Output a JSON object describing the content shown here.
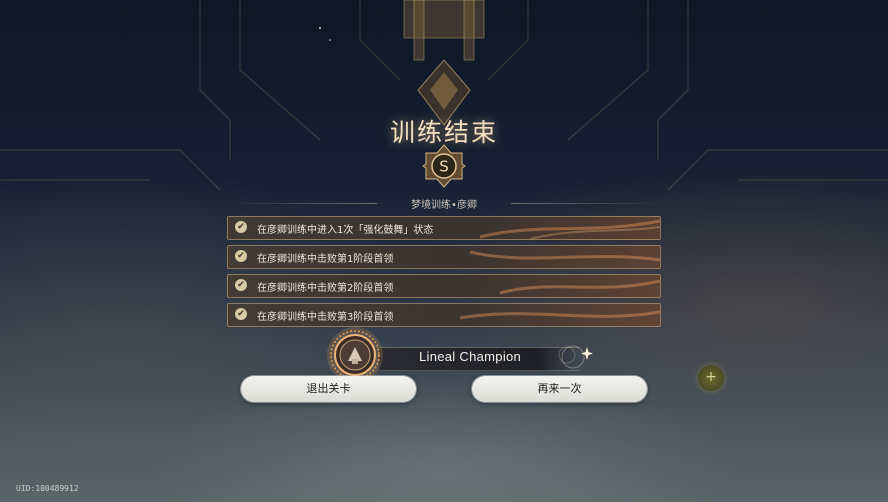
{
  "screen": {
    "title": "训练结束",
    "rank": "S",
    "subtitle": "梦境训练•彦卿"
  },
  "objectives": [
    {
      "text": "在彦卿训练中进入1次「强化鼓舞」状态",
      "completed": true
    },
    {
      "text": "在彦卿训练中击败第1阶段首领",
      "completed": true
    },
    {
      "text": "在彦卿训练中击败第2阶段首领",
      "completed": true
    },
    {
      "text": "在彦卿训练中击败第3阶段首领",
      "completed": true
    }
  ],
  "reward": {
    "name": "Lineal Champion"
  },
  "buttons": {
    "exit": "退出关卡",
    "retry": "再来一次",
    "plus": "+"
  },
  "footer": {
    "uid": "UID:100489912"
  },
  "colors": {
    "gold_text": "#f3dfbf",
    "objective_border": "#cdaf82",
    "button_bg": "#f4f3ef",
    "plus_btn": "#6b6a2c"
  },
  "icons": {
    "check": "check-circle-icon",
    "rank": "rank-s-emblem-icon",
    "reward": "achievement-medal-icon"
  }
}
